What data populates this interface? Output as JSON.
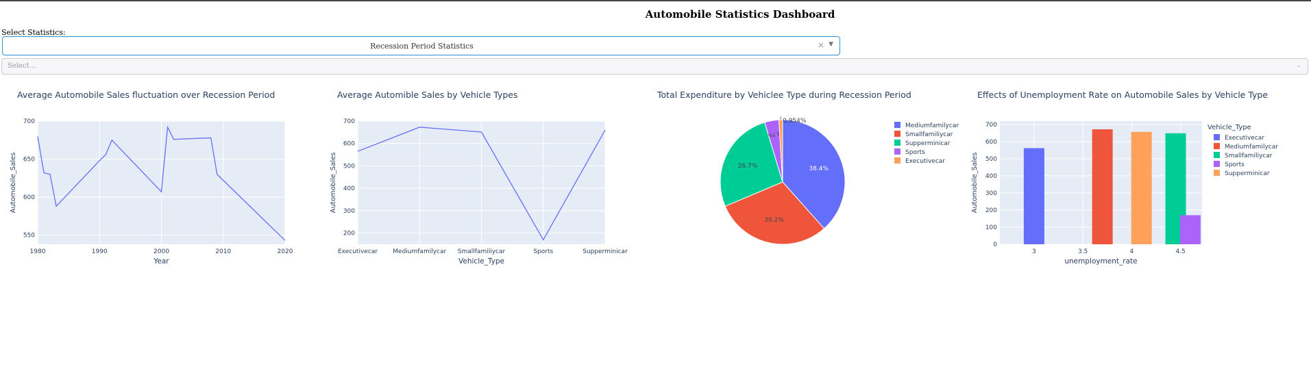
{
  "header": {
    "title": "Automobile Statistics Dashboard"
  },
  "controls": {
    "label": "Select Statistics:",
    "stat_dropdown": {
      "value": "Recession Period Statistics",
      "clear_icon": "close-icon",
      "arrow_icon": "chevron-down-icon"
    },
    "year_dropdown": {
      "placeholder": "Select...",
      "arrow_icon": "chevron-down-icon"
    }
  },
  "colors": {
    "plot_bg": "#E5ECF6",
    "line": "#636EFA",
    "series": [
      "#636EFA",
      "#EF553B",
      "#00CC96",
      "#AB63FA",
      "#FFA15A"
    ]
  },
  "chart_data": [
    {
      "type": "line",
      "title": "Average Automobile Sales fluctuation over Recession Period",
      "xlabel": "Year",
      "ylabel": "Automobile_Sales",
      "xlim": [
        1980,
        2020
      ],
      "ylim": [
        538,
        700
      ],
      "xticks": [
        1980,
        1990,
        2000,
        2010,
        2020
      ],
      "yticks": [
        550,
        600,
        650,
        700
      ],
      "x": [
        1980,
        1981,
        1982,
        1983,
        1990,
        1991,
        1992,
        2000,
        2001,
        2002,
        2008,
        2009,
        2020
      ],
      "y": [
        680,
        632,
        630,
        588,
        648,
        656,
        675,
        607,
        692,
        676,
        678,
        630,
        543
      ]
    },
    {
      "type": "line",
      "title": "Average Automible Sales by Vehicle Types",
      "xlabel": "Vehicle_Type",
      "ylabel": "Automobile_Sales",
      "ylim": [
        150,
        700
      ],
      "yticks": [
        200,
        300,
        400,
        500,
        600,
        700
      ],
      "categories": [
        "Executivecar",
        "Mediumfamilycar",
        "Smallfamiliycar",
        "Sports",
        "Supperminicar"
      ],
      "values": [
        565,
        673,
        651,
        170,
        660
      ]
    },
    {
      "type": "pie",
      "title": "Total Expenditure by Vehiclee Type during Recession Period",
      "legend": [
        "Mediumfamilycar",
        "Smallfamiliycar",
        "Supperminicar",
        "Sports",
        "Executivecar"
      ],
      "values": [
        38.4,
        30.2,
        26.7,
        3.7,
        0.954
      ],
      "labels": [
        "38.4%",
        "30.2%",
        "26.7%",
        "3.7%",
        "0.954%"
      ]
    },
    {
      "type": "bar",
      "title": "Effects of Unemployment Rate on Automobile Sales by Vehicle Type",
      "xlabel": "unemployment_rate",
      "ylabel": "Automobile_Sales",
      "xlim": [
        2.65,
        4.72
      ],
      "ylim": [
        0,
        720
      ],
      "xticks": [
        3,
        3.5,
        4,
        4.5
      ],
      "xtick_labels": [
        "3",
        "3.5",
        "4",
        "4.5"
      ],
      "yticks": [
        0,
        100,
        200,
        300,
        400,
        500,
        600,
        700
      ],
      "legend_title": "Vehicle_Type",
      "legend": [
        "Executivecar",
        "Mediumfamilycar",
        "Smallfamiliycar",
        "Sports",
        "Supperminicar"
      ],
      "bars": [
        {
          "x": 3.0,
          "value": 562,
          "series": 0
        },
        {
          "x": 3.7,
          "value": 672,
          "series": 1
        },
        {
          "x": 4.1,
          "value": 657,
          "series": 4
        },
        {
          "x": 4.45,
          "value": 649,
          "series": 2
        },
        {
          "x": 4.6,
          "value": 170,
          "series": 3
        }
      ]
    }
  ]
}
